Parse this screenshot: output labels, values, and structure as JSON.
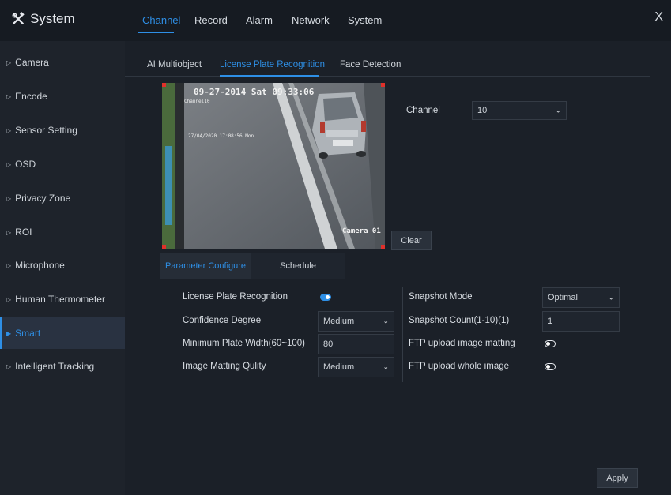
{
  "app": {
    "title": "System",
    "close_label": "X"
  },
  "top_tabs": [
    {
      "label": "Channel",
      "active": true
    },
    {
      "label": "Record",
      "active": false
    },
    {
      "label": "Alarm",
      "active": false
    },
    {
      "label": "Network",
      "active": false
    },
    {
      "label": "System",
      "active": false
    }
  ],
  "sidebar": {
    "items": [
      {
        "label": "Camera"
      },
      {
        "label": "Encode"
      },
      {
        "label": "Sensor Setting"
      },
      {
        "label": "OSD"
      },
      {
        "label": "Privacy Zone"
      },
      {
        "label": "ROI"
      },
      {
        "label": "Microphone"
      },
      {
        "label": "Human Thermometer"
      },
      {
        "label": "Smart",
        "active": true
      },
      {
        "label": "Intelligent Tracking"
      }
    ]
  },
  "sub_tabs": [
    {
      "label": "AI Multiobject"
    },
    {
      "label": "License Plate Recognition",
      "active": true
    },
    {
      "label": "Face Detection"
    }
  ],
  "video": {
    "osd_datetime": "09-27-2014 Sat 09:33:06",
    "osd_channel": "Channel10",
    "osd_small_datetime": "27/04/2020 17:08:56 Mon",
    "osd_camera": "Camera 01"
  },
  "channel": {
    "label": "Channel",
    "value": "10"
  },
  "clear_label": "Clear",
  "param_tabs": [
    {
      "label": "Parameter Configure",
      "active": true
    },
    {
      "label": "Schedule"
    }
  ],
  "left_params": {
    "lpr": {
      "label": "License Plate Recognition",
      "state": "on"
    },
    "confidence": {
      "label": "Confidence Degree",
      "value": "Medium"
    },
    "min_width": {
      "label": "Minimum Plate Width(60~100)",
      "value": "80"
    },
    "matting_quality": {
      "label": "Image Matting Qulity",
      "value": "Medium"
    }
  },
  "right_params": {
    "snapshot_mode": {
      "label": "Snapshot Mode",
      "value": "Optimal"
    },
    "snapshot_count": {
      "label": "Snapshot Count(1-10)(1)",
      "value": "1"
    },
    "ftp_matting": {
      "label": "FTP upload image matting",
      "state": "off"
    },
    "ftp_whole": {
      "label": "FTP upload whole image",
      "state": "off"
    }
  },
  "apply_label": "Apply",
  "colors": {
    "accent": "#2e8fe6",
    "bg": "#161b22",
    "panel": "#1b2028"
  }
}
